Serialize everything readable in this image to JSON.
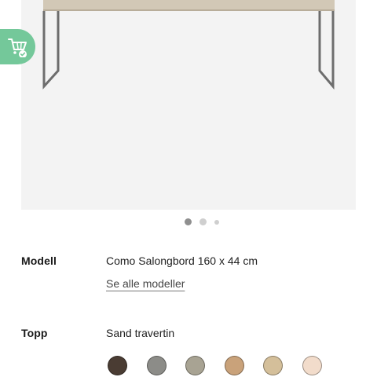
{
  "specs": {
    "model": {
      "label": "Modell",
      "value": "Como Salongbord 160 x 44 cm",
      "link": "Se alle modeller"
    },
    "top": {
      "label": "Topp",
      "value": "Sand travertin"
    }
  },
  "carousel": {
    "slides": 3,
    "active": 1
  },
  "swatches": [
    {
      "name": "dark-brown",
      "color": "#4a3c33"
    },
    {
      "name": "grey",
      "color": "#8c8c88"
    },
    {
      "name": "greige",
      "color": "#a8a393"
    },
    {
      "name": "oak",
      "color": "#c9a27a"
    },
    {
      "name": "sand",
      "color": "#d4bf9a"
    },
    {
      "name": "blush",
      "color": "#f2dccb"
    }
  ],
  "colors": {
    "cart_button": "#74c89a",
    "image_background": "#f3f3f3",
    "table_top": "#d2c8b6",
    "table_frame": "#6d6d6d"
  },
  "icons": {
    "cart": "cart-check-icon"
  }
}
